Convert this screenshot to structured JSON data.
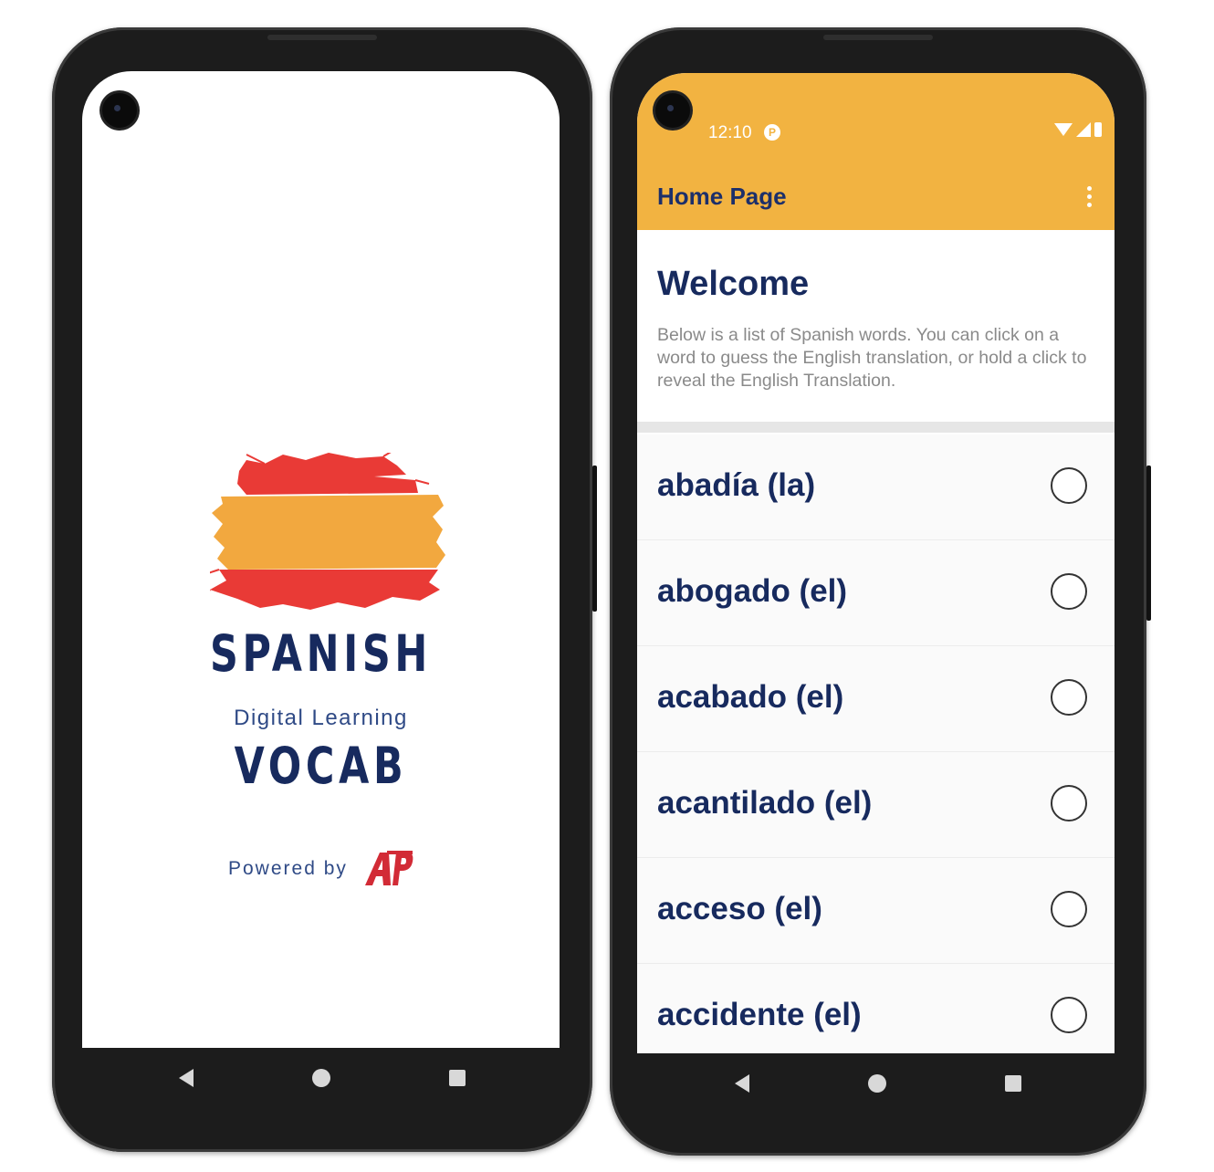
{
  "splash": {
    "brand_title": "SPANISH",
    "brand_tagline": "Digital Learning",
    "brand_subtitle": "VOCAB",
    "powered_by": "Powered by",
    "partner_logo": "AP",
    "flag_colors": {
      "red": "#e93a36",
      "yellow": "#f2a83f"
    }
  },
  "home": {
    "status": {
      "time": "12:10",
      "app_icon": "P"
    },
    "appbar": {
      "title": "Home Page",
      "menu_icon": "more-vert-icon",
      "color": "#f2b341"
    },
    "welcome": {
      "title": "Welcome",
      "body": "Below is a list of Spanish words. You can click on a word to guess the English translation, or hold a click to reveal the English Translation."
    },
    "words": [
      {
        "label": "abadía (la)",
        "selected": false
      },
      {
        "label": "abogado (el)",
        "selected": false
      },
      {
        "label": "acabado (el)",
        "selected": false
      },
      {
        "label": "acantilado (el)",
        "selected": false
      },
      {
        "label": "acceso (el)",
        "selected": false
      },
      {
        "label": "accidente (el)",
        "selected": false
      }
    ]
  },
  "nav": {
    "back_icon": "back-icon",
    "home_icon": "home-icon",
    "recents_icon": "recents-icon"
  }
}
